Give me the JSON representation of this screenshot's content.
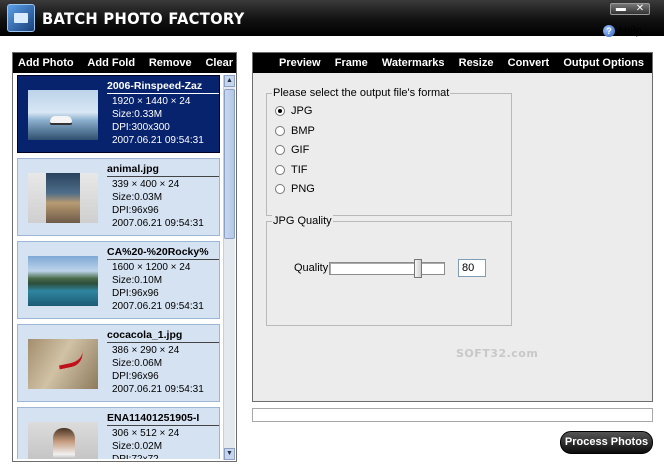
{
  "app": {
    "title": "BATCH PHOTO FACTORY",
    "min_glyph": "▬",
    "close_glyph": "✕"
  },
  "help": {
    "icon_glyph": "?",
    "label": "Help"
  },
  "left_toolbar": {
    "add_photo": "Add Photo",
    "add_folder": "Add Fold",
    "remove": "Remove",
    "clear": "Clear"
  },
  "scroll": {
    "up_glyph": "▲",
    "down_glyph": "▼"
  },
  "photos": [
    {
      "name": "2006-Rinspeed-Zaz",
      "dims": "1920 × 1440 × 24",
      "size": "Size:0.33M",
      "dpi": "DPI:300x300",
      "date": "2007.06.21 09:54:31",
      "selected": true,
      "thumb": "car"
    },
    {
      "name": "animal.jpg",
      "dims": "339 × 400 × 24",
      "size": "Size:0.03M",
      "dpi": "DPI:96x96",
      "date": "2007.06.21 09:54:31",
      "selected": false,
      "thumb": "book"
    },
    {
      "name": "CA%20-%20Rocky%",
      "dims": "1600 × 1200 × 24",
      "size": "Size:0.10M",
      "dpi": "DPI:96x96",
      "date": "2007.06.21 09:54:31",
      "selected": false,
      "thumb": "lake"
    },
    {
      "name": "cocacola_1.jpg",
      "dims": "386 × 290 × 24",
      "size": "Size:0.06M",
      "dpi": "DPI:96x96",
      "date": "2007.06.21 09:54:31",
      "selected": false,
      "thumb": "cola"
    },
    {
      "name": "ENA11401251905-I",
      "dims": "306 × 512 × 24",
      "size": "Size:0.02M",
      "dpi": "DPI:72x72",
      "date": "",
      "selected": false,
      "thumb": "person"
    }
  ],
  "tabs": {
    "preview": "Preview",
    "frame": "Frame",
    "watermarks": "Watermarks",
    "resize": "Resize",
    "convert": "Convert",
    "output_options": "Output Options"
  },
  "format_group": {
    "label": "Please select the output file's format",
    "options": [
      "JPG",
      "BMP",
      "GIF",
      "TIF",
      "PNG"
    ],
    "selected": "JPG"
  },
  "quality_group": {
    "label": "JPG Quality",
    "field_label": "Quality",
    "value": "80",
    "slider_fraction": 0.8
  },
  "watermark_text": "SOFT32.com",
  "process_button": "Process Photos"
}
